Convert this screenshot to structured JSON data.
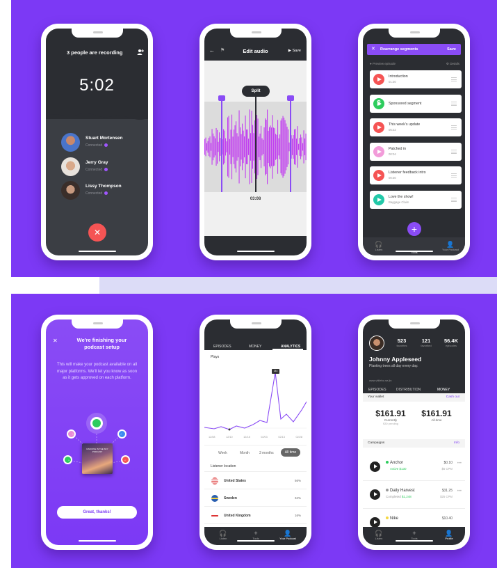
{
  "colors": {
    "accent": "#7c39f5",
    "dark": "#2b2d32",
    "red": "#f55454",
    "green": "#2dcc5d",
    "teal": "#22c8a8",
    "pink": "#f29bd9"
  },
  "phone1": {
    "title": "3 people are recording",
    "timer": "5:02",
    "people": [
      {
        "name": "Stuart Mortensen",
        "status": "Connected"
      },
      {
        "name": "Jerry Gray",
        "status": "Connected"
      },
      {
        "name": "Lissy Thompson",
        "status": "Connected"
      }
    ],
    "icons": {
      "add": "add-person-icon",
      "end": "close-icon"
    }
  },
  "phone2": {
    "title": "Edit audio",
    "save": "Save",
    "split": "Split",
    "time": "03:08"
  },
  "phone3": {
    "header": "Rearrange segments",
    "save": "Save",
    "preview": "Preview episode",
    "details": "Details",
    "segments": [
      {
        "title": "Introduction",
        "sub": "01:30",
        "color": "#f55454"
      },
      {
        "title": "Sponsored segment",
        "sub": "",
        "color": "#2dcc5d"
      },
      {
        "title": "This week's update",
        "sub": "05:22",
        "color": "#f55454"
      },
      {
        "title": "Patched in",
        "sub": "00:04",
        "color": "#f29bd9"
      },
      {
        "title": "Listener feedback intro",
        "sub": "00:30",
        "color": "#f55454"
      },
      {
        "title": "Love the show!",
        "sub": "Baggage Claim",
        "color": "#22c8a8"
      }
    ],
    "nav": [
      "Listen",
      "Tools",
      "Your Podcast"
    ]
  },
  "phone4": {
    "title": "We're finishing your podcast setup",
    "body": "This will make your podcast available on all major platforms. We'll let you know as soon as it gets approved on each platform.",
    "cover": "DANCING IN THE SKY PODCAST",
    "button": "Great, thanks!"
  },
  "phone5": {
    "tabs": [
      "EPISODES",
      "MONEY",
      "ANALYTICS"
    ],
    "plays": "Plays",
    "peak": "144",
    "xticks": [
      "12/08",
      "12/10",
      "12/18",
      "02/03",
      "02/13",
      "02/28"
    ],
    "ranges": [
      "Week",
      "Month",
      "3 months",
      "All time"
    ],
    "location_title": "Listener location",
    "locations": [
      {
        "country": "United States",
        "pct": "56%"
      },
      {
        "country": "Sweden",
        "pct": "34%"
      },
      {
        "country": "United Kingdom",
        "pct": "16%"
      }
    ],
    "nav": [
      "Listen",
      "Tools",
      "Your Podcast"
    ]
  },
  "phone6": {
    "stats": [
      {
        "v": "523",
        "l": "favorites"
      },
      {
        "v": "121",
        "l": "favorited"
      },
      {
        "v": "56.4K",
        "l": "episodes"
      }
    ],
    "name": "Johnny Appleseed",
    "bio": "Planting trees all day every day.",
    "url": "www.vitileho.se.jin",
    "tabs": [
      "EPISODES",
      "DISTRIBUTION",
      "MONEY"
    ],
    "wallet": "Your wallet",
    "cashout": "Cash out",
    "currently": {
      "v": "$161.91",
      "l": "Currently",
      "s": "$30 pending"
    },
    "alltime": {
      "v": "$161.91",
      "l": "All-time"
    },
    "campaigns": "Campaigns",
    "info": "Info",
    "items": [
      {
        "name": "Anchor",
        "status": "Active",
        "amt": "$130",
        "price": "$0.10",
        "cpm": "$5 CPM",
        "dot": "#2dcc5d"
      },
      {
        "name": "Daily Harvest",
        "status": "Completed",
        "amt": "$1,248",
        "price": "$31.25",
        "cpm": "$25 CPM",
        "dot": "#999999"
      },
      {
        "name": "Nike",
        "status": "Active",
        "amt": "$1,25",
        "price": "$10.40",
        "cpm": "$25 CPM",
        "dot": "#f5d742"
      }
    ],
    "nav": [
      "Listen",
      "Tools",
      "Profile"
    ]
  }
}
